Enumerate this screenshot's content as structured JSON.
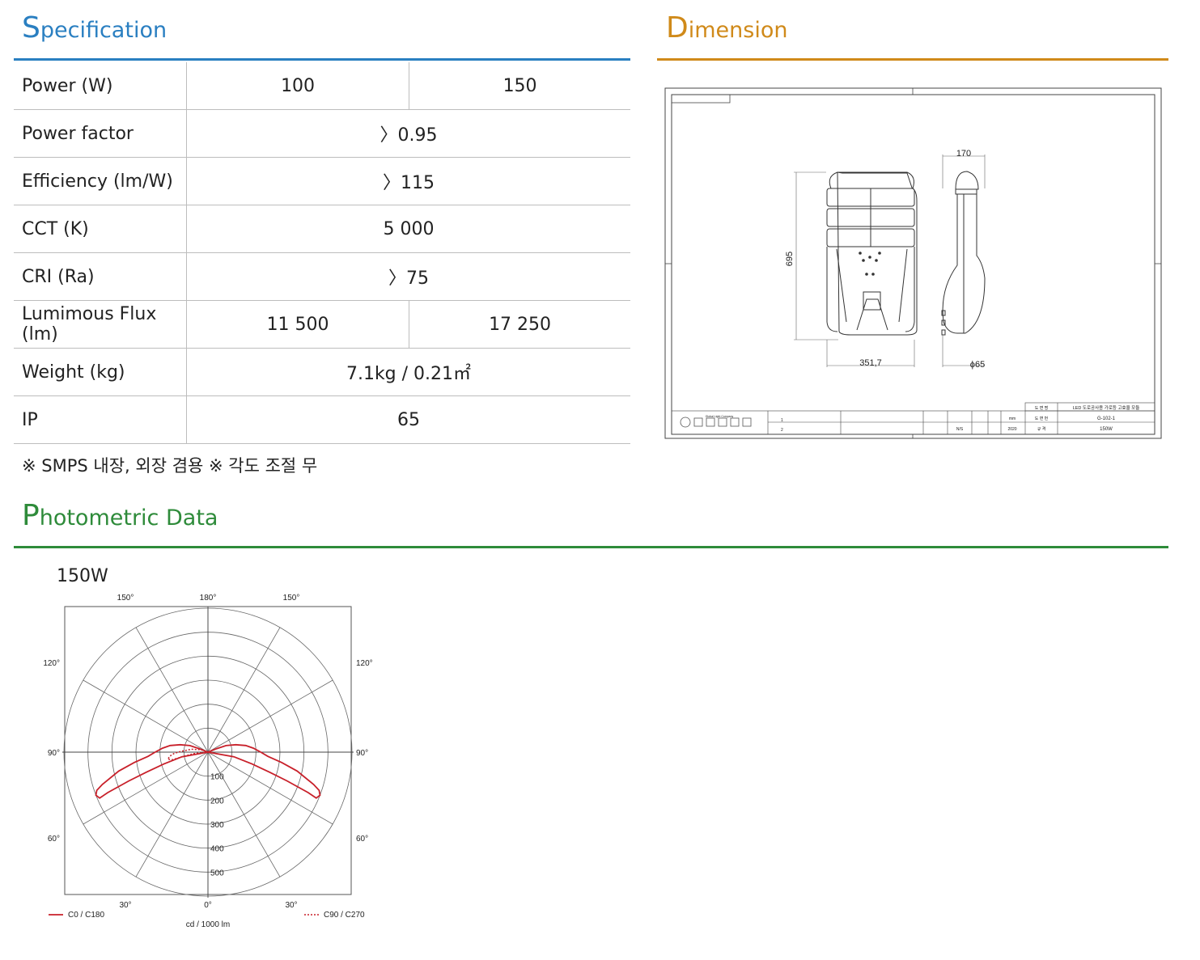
{
  "specification": {
    "heading_first": "S",
    "heading_rest": "pecification",
    "rows": [
      {
        "label": "Power (W)",
        "values": [
          "100",
          "150"
        ]
      },
      {
        "label": "Power factor",
        "values": [
          "〉0.95"
        ]
      },
      {
        "label": "Efficiency (lm/W)",
        "values": [
          "〉115"
        ]
      },
      {
        "label": "CCT (K)",
        "values": [
          "5 000"
        ]
      },
      {
        "label": "CRI (Ra)",
        "values": [
          "〉75"
        ]
      },
      {
        "label": "Lumimous Flux (lm)",
        "values": [
          "11 500",
          "17 250"
        ]
      },
      {
        "label": "Weight (kg)",
        "values": [
          "7.1kg / 0.21㎡"
        ]
      },
      {
        "label": "IP",
        "values": [
          "65"
        ]
      }
    ],
    "note": "※ SMPS 내장, 외장 겸용 ※ 각도 조절 무",
    "accent_color": "#2a7fc1"
  },
  "dimension": {
    "heading_first": "D",
    "heading_rest": "imension",
    "accent_color": "#d08a1a",
    "labels": {
      "height": "695",
      "width": "351,7",
      "depth": "170",
      "diameter": "ϕ65"
    },
    "title_block": {
      "drawing_name_label": "도 면 명",
      "drawing_name": "LED 도로공사용 가로등 고효율 모듈",
      "drawing_no_label": "도 면 번",
      "drawing_no": "G-102-1",
      "spec_label": "규 격",
      "spec": "150W",
      "unit": "mm",
      "year": "2020",
      "scale": "N/S",
      "company": "Global Light Company",
      "rev_1": "1",
      "rev_2": "2"
    }
  },
  "photometric": {
    "heading_first": "P",
    "heading_rest": "hotometric Data",
    "accent_color": "#2e8b3a",
    "series_title": "150W",
    "angle_labels_top": [
      "150°",
      "180°",
      "150°"
    ],
    "angle_labels_left": [
      "120°",
      "90°",
      "60°"
    ],
    "angle_labels_right": [
      "120°",
      "90°",
      "60°"
    ],
    "angle_labels_bottom": [
      "30°",
      "0°",
      "30°"
    ],
    "legend_c0": "C0 / C180",
    "legend_c90": "C90 / C270",
    "unit_label": "cd / 1000 lm",
    "line_color": "#c8202a"
  },
  "chart_data": {
    "type": "polar",
    "radial_ticks": [
      100,
      200,
      300,
      400,
      500
    ],
    "rmax": 600,
    "series": [
      {
        "name": "C0 / C180",
        "style": "solid",
        "points": [
          [
            90,
            0
          ],
          [
            80,
            110
          ],
          [
            75,
            190
          ],
          [
            72,
            270
          ],
          [
            70,
            350
          ],
          [
            68,
            450
          ],
          [
            67,
            490
          ],
          [
            69,
            500
          ],
          [
            71,
            490
          ],
          [
            73,
            460
          ],
          [
            78,
            380
          ],
          [
            82,
            310
          ],
          [
            86,
            250
          ],
          [
            90,
            220
          ],
          [
            95,
            190
          ],
          [
            100,
            160
          ],
          [
            105,
            120
          ],
          [
            110,
            80
          ],
          [
            112,
            40
          ],
          [
            110,
            0
          ]
        ]
      }
    ]
  }
}
